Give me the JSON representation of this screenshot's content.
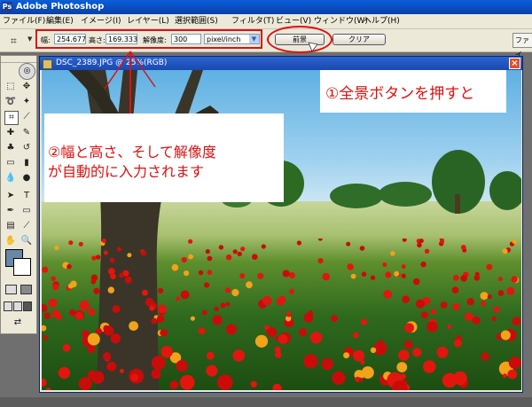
{
  "window": {
    "title": "Adobe Photoshop",
    "app_icon": "Ps"
  },
  "menu": [
    "ファイル(F)",
    "編集(E)",
    "イメージ(I)",
    "レイヤー(L)",
    "選択範囲(S)",
    "フィルタ(T)",
    "ビュー(V)",
    "ウィンドウ(W)",
    "ヘルプ(H)"
  ],
  "options": {
    "width_label": "幅:",
    "width_value": "254.677",
    "height_label": "高さ:",
    "height_value": "169.333",
    "resolution_label": "解像度:",
    "resolution_value": "300",
    "unit_value": "pixel/inch",
    "front_button": "前景",
    "clear_button": "クリア",
    "palette_tab": "ファイ"
  },
  "document": {
    "title": "DSC_2389.JPG @ 25%(RGB)",
    "close": "×"
  },
  "annotations": {
    "callout1": "①全景ボタンを押すと",
    "callout2_line1": "②幅と高さ、そして解像度",
    "callout2_line2": "が自動的に入力されます"
  },
  "colors": {
    "foreground": "#6a87a8",
    "background": "#ffffff",
    "annotation": "#e01010"
  }
}
